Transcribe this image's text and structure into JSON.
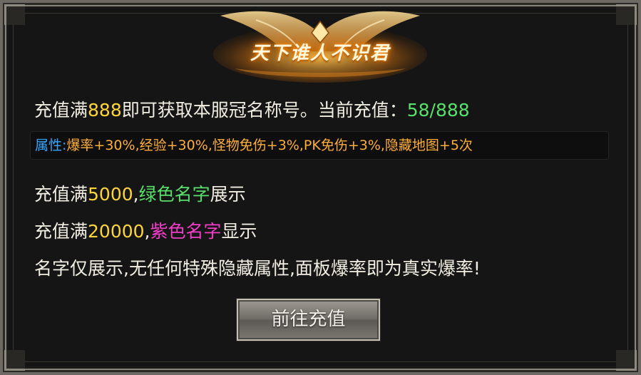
{
  "title": "天下谁人不识君",
  "line1": {
    "prefix": "充值满",
    "amount": "888",
    "middle": "即可获取本服冠名称号。当前充值：",
    "progress": "58/888"
  },
  "attributes": {
    "label": "属性",
    "colon": ":",
    "text": "爆率+30%,经验+30%,怪物免伤+3%,PK免伤+3%,隐藏地图+5次"
  },
  "line3": {
    "prefix": "充值满",
    "amount": "5000",
    "comma": ",",
    "highlight": "绿色名字",
    "suffix": "展示"
  },
  "line4": {
    "prefix": "充值满",
    "amount": "20000",
    "comma": ",",
    "highlight": "紫色名字",
    "suffix": "显示"
  },
  "line5": {
    "text": "名字仅展示,无任何特殊隐藏属性,面板爆率即为真实爆率!"
  },
  "button": {
    "label": "前往充值"
  },
  "colors": {
    "amount": "#ffd43a",
    "green_name": "#58e06a",
    "purple_name": "#f23ec8",
    "attr_label": "#36a6ff",
    "attr_text": "#ffae3a"
  }
}
